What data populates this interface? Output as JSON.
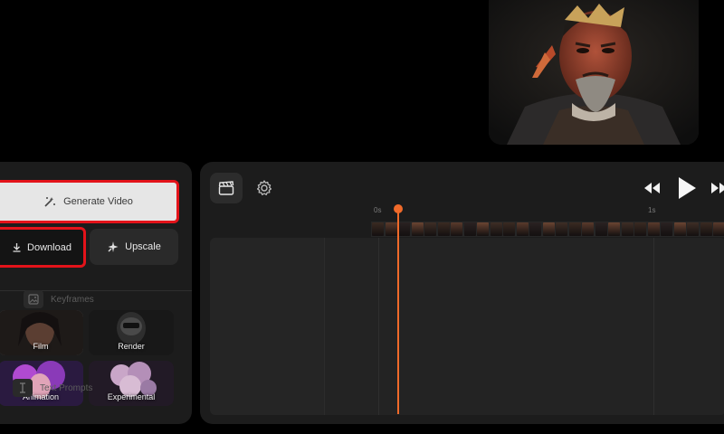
{
  "preview": {
    "description_icon": "samurai-portrait-image"
  },
  "actions": {
    "generate_label": "Generate Video",
    "download_label": "Download",
    "upscale_label": "Upscale"
  },
  "styles": [
    {
      "label": "Film"
    },
    {
      "label": "Render"
    },
    {
      "label": "Animation"
    },
    {
      "label": "Experimental"
    }
  ],
  "timeline": {
    "tick_start": "0s",
    "tick_mid": "1s",
    "tracks": [
      {
        "label": "Keyframes",
        "icon": "image-icon"
      },
      {
        "label": "Text Prompts",
        "icon": "text-cursor-icon"
      }
    ],
    "accent_color": "#f06a2a"
  },
  "highlight_color": "#e3131a"
}
